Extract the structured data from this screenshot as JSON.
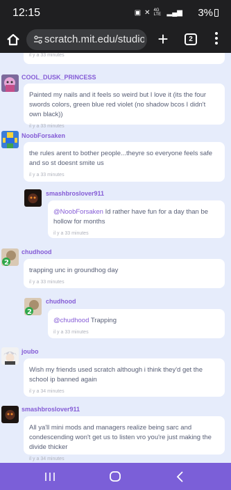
{
  "status_bar": {
    "time": "12:15",
    "network": "4G LTE",
    "battery": "3%"
  },
  "browser": {
    "url": "scratch.mit.edu/studios/",
    "tab_count": "2"
  },
  "comments": [
    {
      "id": "top-partial",
      "time": "il y a 33 minutes"
    },
    {
      "id": "c1",
      "username": "COOL_DUSK_PRINCESS",
      "text": "Painted my nails and it feels so weird but I love it (its the four swords colors, green blue red violet (no shadow bcos I didn't own black))",
      "time": "il y a 33 minutes",
      "avatar": "pink-character-avatar"
    },
    {
      "id": "c2",
      "username": "NoobForsaken",
      "text": "the rules arent to bother people...theyre so everyone feels safe and so st doesnt smite us",
      "time": "il y a 33 minutes",
      "avatar": "roblox-noob-avatar"
    },
    {
      "id": "r1",
      "username": "smashbroslover911",
      "mention": "@NoobForsaken",
      "text": " Id rather have fun for a day than be hollow for months",
      "time": "il y a 33 minutes",
      "avatar": "dark-creature-avatar"
    },
    {
      "id": "c3",
      "username": "chudhood",
      "text": "trapping unc in groundhog day",
      "time": "il y a 33 minutes",
      "avatar": "sackboy-avatar"
    },
    {
      "id": "r2",
      "username": "chudhood",
      "mention": "@chudhood",
      "text": " Trapping",
      "time": "il y a 33 minutes",
      "avatar": "sackboy-avatar"
    },
    {
      "id": "c4",
      "username": "joubo",
      "text": "Wish my friends used scratch although i think they'd get the school ip banned again",
      "time": "il y a 34 minutes",
      "avatar": "anime-boy-avatar"
    },
    {
      "id": "c5",
      "username": "smashbroslover911",
      "text": "All ya'll mini mods and managers realize being sarc and condescending won't get us to listen vro you're just making the divide thicker",
      "time": "il y a 34 minutes",
      "avatar": "dark-creature-avatar"
    }
  ],
  "colors": {
    "accent": "#855cd6",
    "page_bg": "#e6ecfb",
    "nav_bar": "#7b5fd8"
  }
}
